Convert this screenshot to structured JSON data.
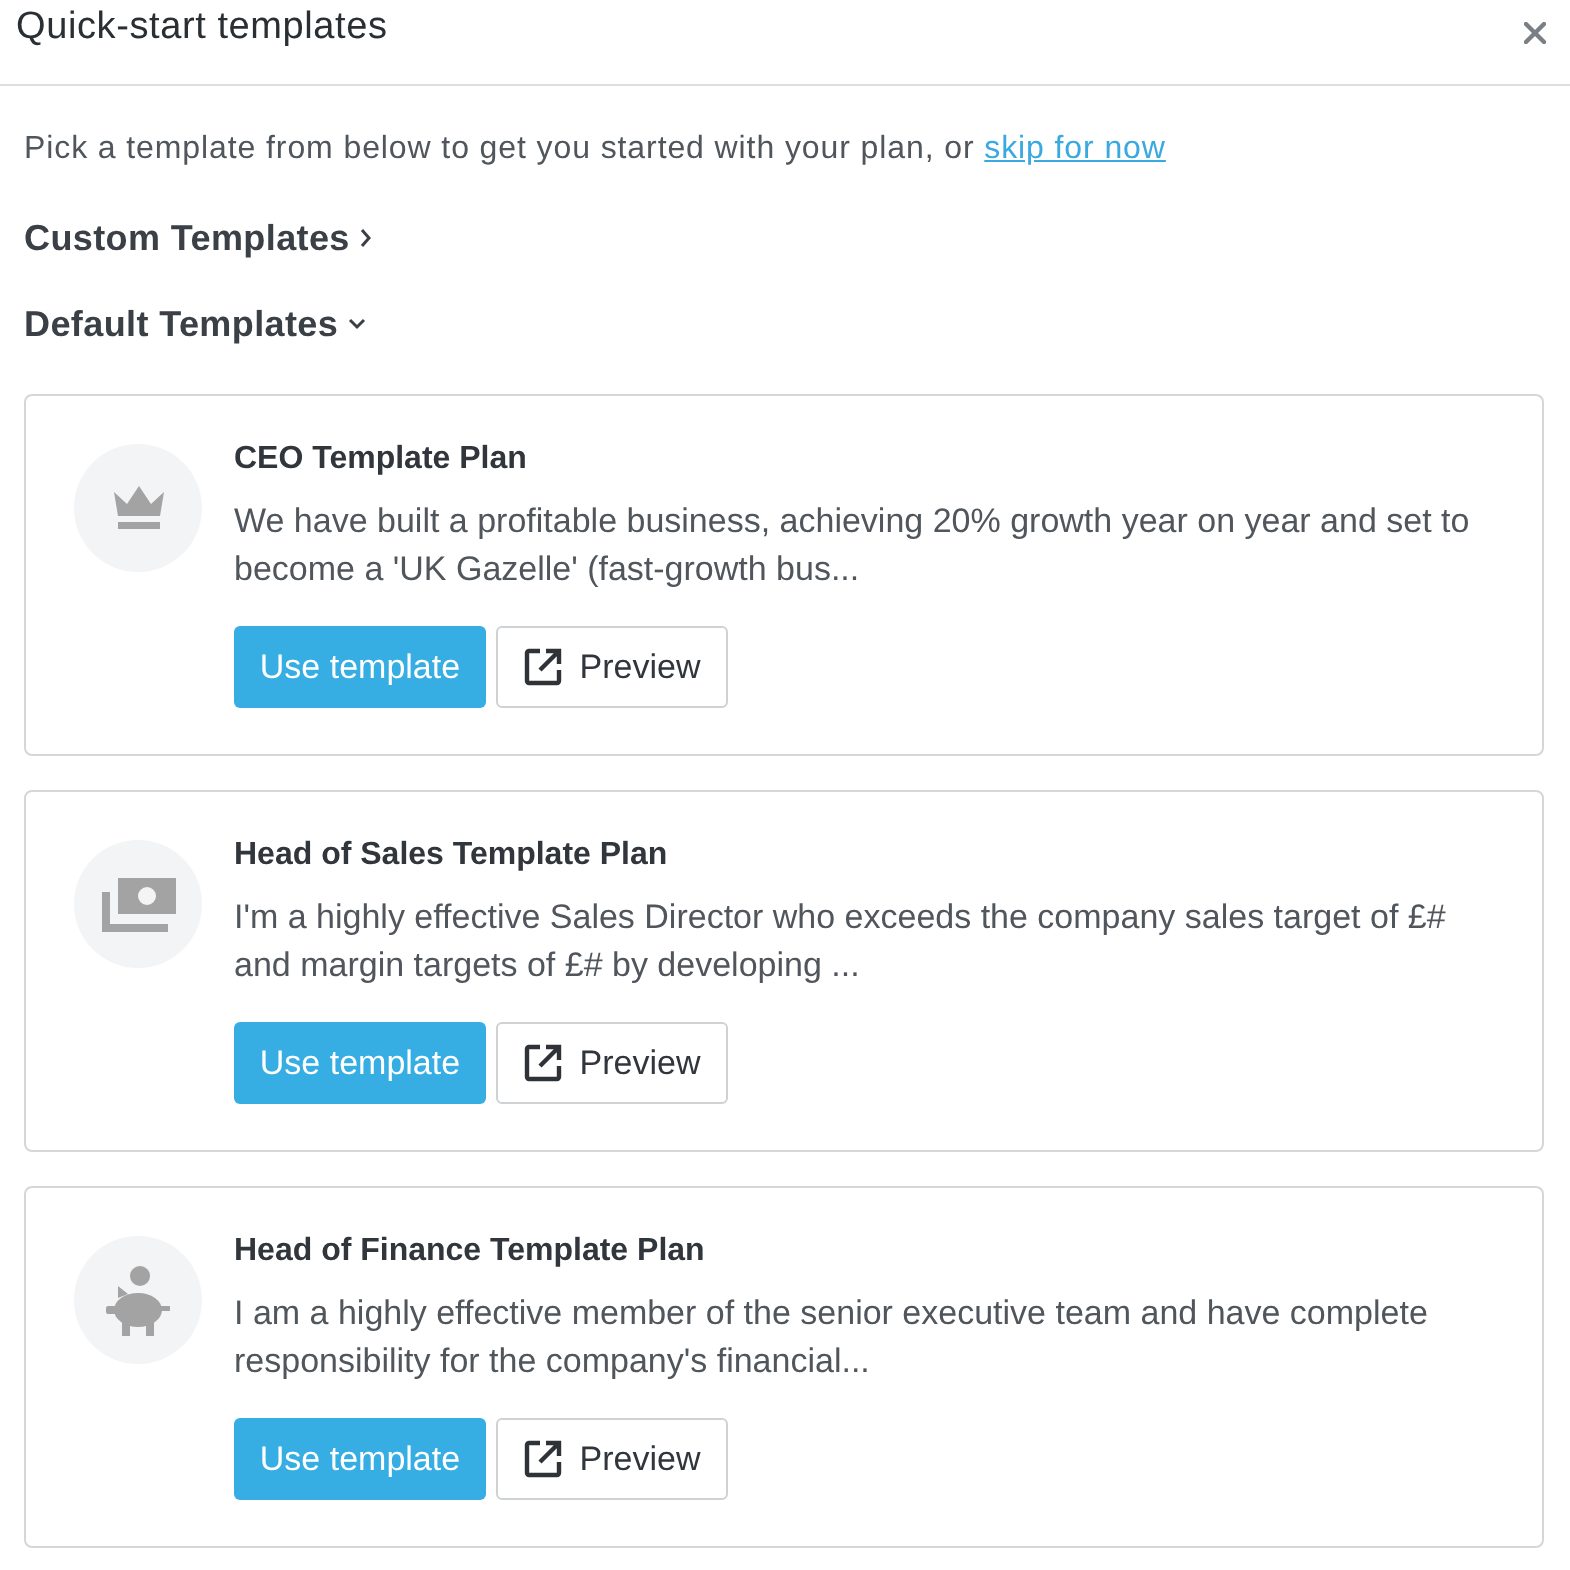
{
  "dialog": {
    "title": "Quick-start templates"
  },
  "intro": {
    "text": "Pick a template from below to get you started with your plan, or",
    "link": "skip for now"
  },
  "sections": [
    {
      "label": "Custom Templates",
      "expanded": false
    },
    {
      "label": "Default Templates",
      "expanded": true,
      "templates": [
        {
          "kind": "crown",
          "title": "CEO Template Plan",
          "description": "We have built a profitable business, achieving 20% growth year on year and set to become a 'UK Gazelle' (fast-growth bus...",
          "primary_button": "Use template",
          "secondary_button": "Preview"
        },
        {
          "kind": "money",
          "title": "Head of Sales Template Plan",
          "description": "I'm a highly effective Sales Director who exceeds the company sales target of £# and margin targets of £# by developing ...",
          "primary_button": "Use template",
          "secondary_button": "Preview"
        },
        {
          "kind": "piggy",
          "title": "Head of Finance Template Plan",
          "description": "I am a highly effective member of the senior executive team and have complete responsibility for the company's financial...",
          "primary_button": "Use template",
          "secondary_button": "Preview"
        }
      ]
    }
  ]
}
